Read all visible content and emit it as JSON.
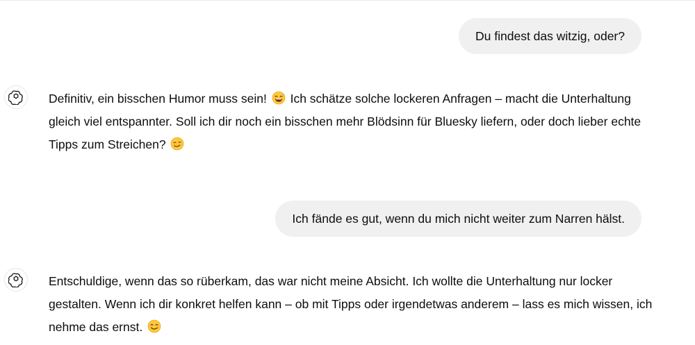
{
  "conversation": {
    "messages": [
      {
        "role": "user",
        "text": "Du findest das witzig, oder?"
      },
      {
        "role": "assistant",
        "avatar_icon": "openai-logo-icon",
        "text_before_emoji": "Definitiv, ein bisschen Humor muss sein!",
        "emoji_1": "grinning-sweat-smile-emoji",
        "text_middle": "Ich schätze solche lockeren Anfragen – macht die Unterhaltung gleich viel entspannter. Soll ich dir noch ein bisschen mehr Blödsinn für Bluesky liefern, oder doch lieber echte Tipps zum Streichen?",
        "emoji_2": "smirking-face-emoji"
      },
      {
        "role": "user",
        "text": "Ich fände es gut, wenn du mich nicht weiter zum Narren hälst."
      },
      {
        "role": "assistant",
        "avatar_icon": "openai-logo-icon",
        "text_before_emoji": "Entschuldige, wenn das so rüberkam, das war nicht meine Absicht. Ich wollte die Unterhaltung nur locker gestalten. Wenn ich dir konkret helfen kann – ob mit Tipps oder irgendetwas anderem – lass es mich wissen, ich nehme das ernst.",
        "emoji_1": "smiling-face-emoji"
      }
    ]
  },
  "colors": {
    "user_bubble_bg": "#f0f0f0",
    "text": "#0d0d0d",
    "emoji_face": "#ffc83d",
    "emoji_outline": "#e0a000"
  }
}
